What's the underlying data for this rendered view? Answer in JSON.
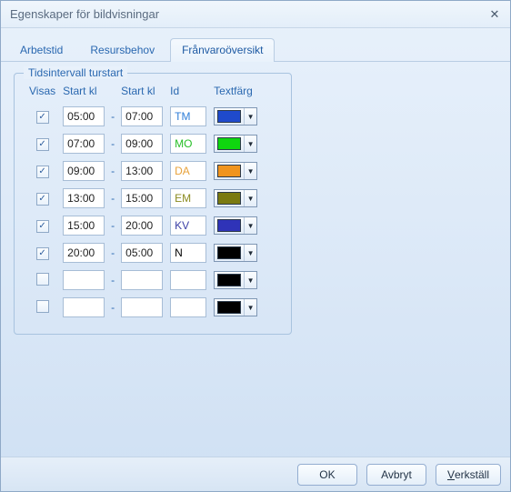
{
  "window": {
    "title": "Egenskaper för bildvisningar",
    "close_label": "✕"
  },
  "tabs": {
    "t0": "Arbetstid",
    "t1": "Resursbehov",
    "t2": "Frånvaroöversikt",
    "active_index": 2
  },
  "group": {
    "legend": "Tidsintervall turstart",
    "headers": {
      "visas": "Visas",
      "start1": "Start kl",
      "start2": "Start kl",
      "id": "Id",
      "color": "Textfärg"
    }
  },
  "rows": [
    {
      "checked": true,
      "start1": "05:00",
      "start2": "07:00",
      "id": "TM",
      "id_color": "#2f7ed8",
      "color": "#1f4acc"
    },
    {
      "checked": true,
      "start1": "07:00",
      "start2": "09:00",
      "id": "MO",
      "id_color": "#26bf26",
      "color": "#0fd60f"
    },
    {
      "checked": true,
      "start1": "09:00",
      "start2": "13:00",
      "id": "DA",
      "id_color": "#e8a23a",
      "color": "#f0941e"
    },
    {
      "checked": true,
      "start1": "13:00",
      "start2": "15:00",
      "id": "EM",
      "id_color": "#8a8a1f",
      "color": "#7a7a10"
    },
    {
      "checked": true,
      "start1": "15:00",
      "start2": "20:00",
      "id": "KV",
      "id_color": "#3b3fa6",
      "color": "#2f33b8"
    },
    {
      "checked": true,
      "start1": "20:00",
      "start2": "05:00",
      "id": "N",
      "id_color": "#000000",
      "color": "#000000"
    },
    {
      "checked": false,
      "start1": "",
      "start2": "",
      "id": "",
      "id_color": "#000000",
      "color": "#000000"
    },
    {
      "checked": false,
      "start1": "",
      "start2": "",
      "id": "",
      "id_color": "#000000",
      "color": "#000000"
    }
  ],
  "buttons": {
    "ok": "OK",
    "cancel": "Avbryt",
    "apply_prefix": "V",
    "apply_rest": "erkställ"
  }
}
